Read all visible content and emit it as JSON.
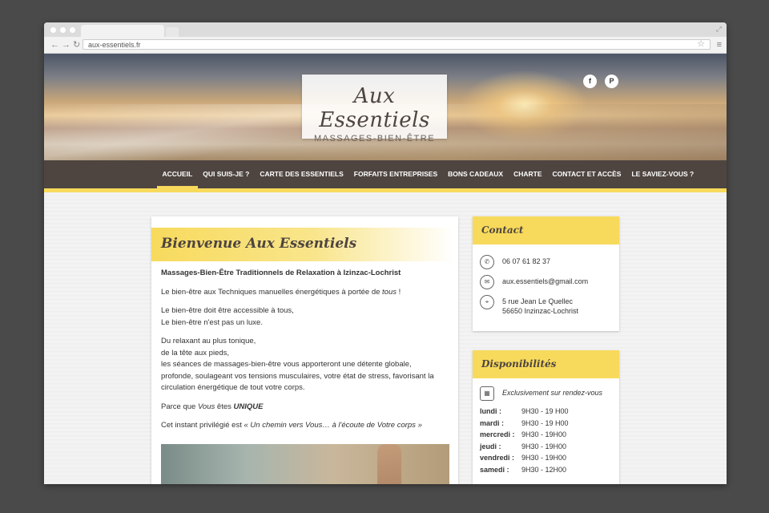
{
  "browser": {
    "url": "aux-essentiels.fr"
  },
  "header": {
    "title": "Aux Essentiels",
    "subtitle": "MASSAGES-BIEN-ÊTRE",
    "social": [
      "f",
      "P"
    ]
  },
  "nav": {
    "items": [
      {
        "label": "ACCUEIL"
      },
      {
        "label": "QUI SUIS-JE ?"
      },
      {
        "label": "CARTE DES ESSENTIELS"
      },
      {
        "label": "FORFAITS ENTREPRISES"
      },
      {
        "label": "BONS CADEAUX"
      },
      {
        "label": "CHARTE"
      },
      {
        "label": "CONTACT ET ACCÈS"
      },
      {
        "label": "LE SAVIEZ-VOUS ?"
      }
    ]
  },
  "main": {
    "heading": "Bienvenue Aux Essentiels",
    "p1": "Massages-Bien-Être Traditionnels de Relaxation à Izinzac-Lochrist",
    "p2_a": "Le bien-être aux Techniques manuelles énergétiques à portée de ",
    "p2_em": "tous",
    "p2_b": " !",
    "p3_l1": "Le bien-être doit être accessible à tous,",
    "p3_l2": "Le bien-être n'est pas un luxe.",
    "p4_l1": "Du relaxant au plus tonique,",
    "p4_l2": "de la tête aux pieds,",
    "p4_l3": "les séances de massages-bien-être vous apporteront une détente globale,",
    "p4_l4": "profonde, soulageant vos tensions musculaires, votre état de stress, favorisant la",
    "p4_l5": "circulation énergétique de tout votre corps.",
    "p5_a": "Parce que ",
    "p5_em": "Vous",
    "p5_b": " êtes ",
    "p5_strong": "UNIQUE",
    "p6_a": "Cet instant privilégié est ",
    "p6_em": "« Un chemin vers Vous… à l'écoute de Votre corps »"
  },
  "contact": {
    "title": "Contact",
    "phone": "06 07 61 82 37",
    "email": "aux.essentiels@gmail.com",
    "address_l1": "5 rue Jean Le Quellec",
    "address_l2": "56650 Inzinzac-Lochrist"
  },
  "dispo": {
    "title": "Disponibilités",
    "note": "Exclusivement sur rendez-vous",
    "days": [
      {
        "day": "lundi :",
        "hours": "9H30 - 19 H00"
      },
      {
        "day": "mardi :",
        "hours": "9H30 - 19 H00"
      },
      {
        "day": "mercredi :",
        "hours": "9H30 - 19H00"
      },
      {
        "day": "jeudi :",
        "hours": "9H30 - 19H00"
      },
      {
        "day": "vendredi :",
        "hours": "9H30 - 19H00"
      },
      {
        "day": "samedi :",
        "hours": "9H30 - 12H00"
      }
    ]
  }
}
